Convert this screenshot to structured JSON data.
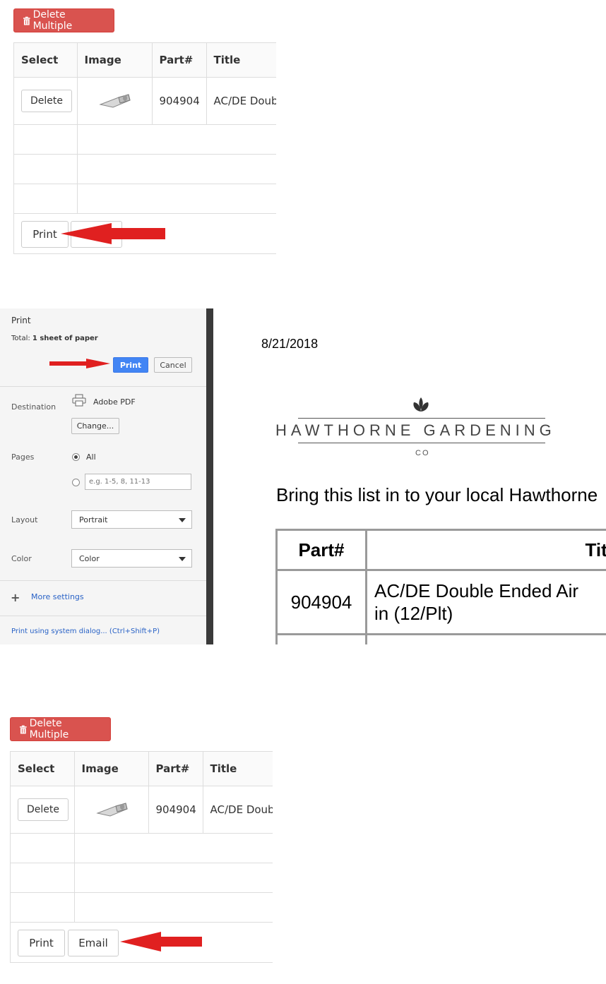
{
  "panel_top": {
    "delete_multiple_label": "Delete Multiple",
    "headers": [
      "Select",
      "Image",
      "Part#",
      "Title"
    ],
    "row": {
      "delete_label": "Delete",
      "part": "904904",
      "title": "AC/DE Double Ended Air"
    },
    "print_label": "Print",
    "email_label": "Email"
  },
  "print_dialog": {
    "title": "Print",
    "total_prefix": "Total: ",
    "total_value": "1 sheet of paper",
    "print_label": "Print",
    "cancel_label": "Cancel",
    "destination_label": "Destination",
    "destination_value": "Adobe PDF",
    "change_label": "Change...",
    "pages_label": "Pages",
    "pages_all": "All",
    "pages_placeholder": "e.g. 1-5, 8, 11-13",
    "layout_label": "Layout",
    "layout_value": "Portrait",
    "color_label": "Color",
    "color_value": "Color",
    "more_settings": "More settings",
    "system_dialog": "Print using system dialog... (Ctrl+Shift+P)"
  },
  "preview": {
    "date": "8/21/2018",
    "brand": "HAWTHORNE GARDENING",
    "brand_co": "CO",
    "intro": "Bring this list in to your local Hawthorne",
    "headers": [
      "Part#",
      "Title"
    ],
    "row": {
      "part": "904904",
      "title": "AC/DE Double Ended Air in (12/Plt)"
    }
  },
  "panel_bottom": {
    "delete_multiple_label": "Delete Multiple",
    "headers": [
      "Select",
      "Image",
      "Part#",
      "Title"
    ],
    "row": {
      "delete_label": "Delete",
      "part": "904904",
      "title": "AC/DE Double Ended Air"
    },
    "print_label": "Print",
    "email_label": "Email"
  },
  "colors": {
    "danger": "#d9534f",
    "arrow": "#e02020",
    "primary": "#4285f4"
  }
}
